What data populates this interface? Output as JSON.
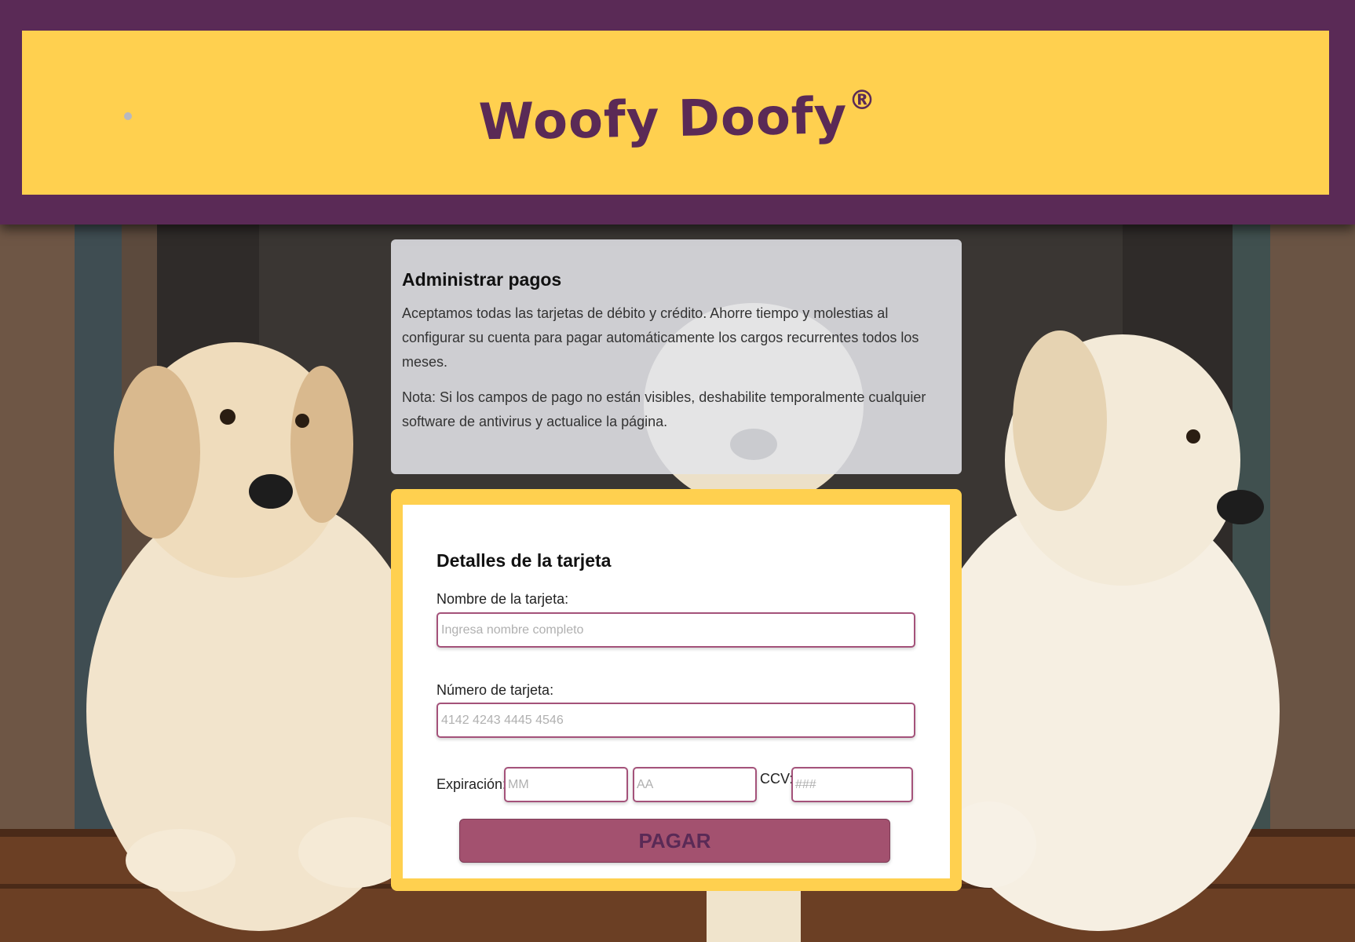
{
  "header": {
    "brand": "Woofy Doofy",
    "brand_mark": "®"
  },
  "info": {
    "title": "Administrar pagos",
    "paragraph_1": "Aceptamos todas las tarjetas de débito y crédito. Ahorre tiempo y molestias al configurar su cuenta para pagar automáticamente los cargos recurrentes todos los meses.",
    "paragraph_2": "Nota: Si los campos de pago no están visibles, deshabilite temporalmente cualquier software de antivirus y actualice la página."
  },
  "payment": {
    "title": "Detalles de la tarjeta",
    "name_label": "Nombre de la tarjeta:",
    "name_placeholder": "Ingresa nombre completo",
    "number_label": "Número de tarjeta:",
    "number_placeholder": "4142 4243 4445 4546",
    "expiration_label": "Expiración:",
    "month_placeholder": "MM",
    "year_placeholder": "AA",
    "ccv_label": "CCV:",
    "ccv_placeholder": "###",
    "submit_label": "PAGAR"
  },
  "colors": {
    "brand_purple": "#5a2a56",
    "brand_yellow": "#ffd04f",
    "button": "#a3516f",
    "input_border": "#a4527a"
  }
}
